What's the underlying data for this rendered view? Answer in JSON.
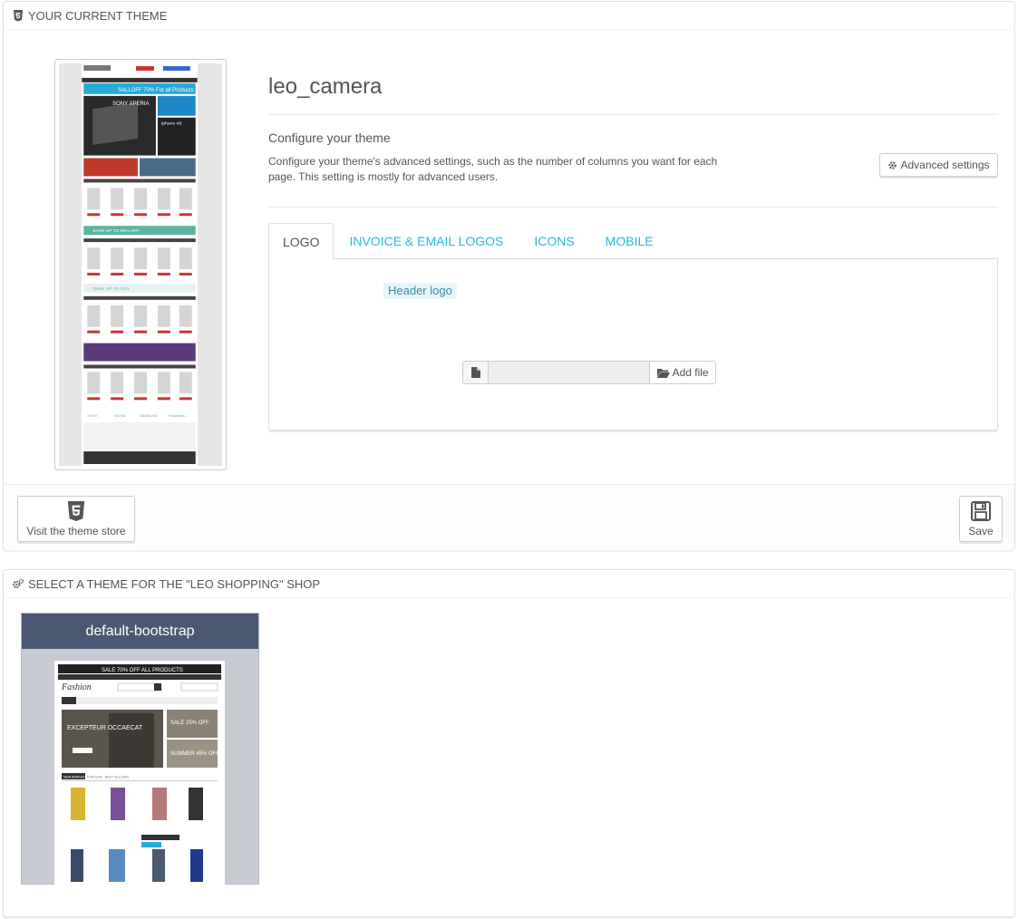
{
  "current_panel": {
    "heading": "YOUR CURRENT THEME",
    "theme_name": "leo_camera",
    "configure_title": "Configure your theme",
    "configure_desc": "Configure your theme's advanced settings, such as the number of columns you want for each page. This setting is mostly for advanced users.",
    "advanced_button": "Advanced settings",
    "tabs": [
      "LOGO",
      "INVOICE & EMAIL LOGOS",
      "ICONS",
      "MOBILE"
    ],
    "header_logo_label": "Header logo",
    "add_file_label": "Add file",
    "file_value": "",
    "visit_store_label": "Visit the theme store",
    "save_label": "Save",
    "thumb_texts": {
      "sale_banner": "SALLOFF 70% For all Products",
      "hero": "SONY XPERIA",
      "side_phone": "Iphone 4S",
      "save_banner_1": "SAVE UP TO 50% OFF",
      "save_banner_2": "SAVE UP TO 20%",
      "brands": [
        "SONY",
        "NOKIA",
        "SAMSUNG",
        "Panasonic"
      ]
    }
  },
  "select_panel": {
    "heading": "SELECT A THEME FOR THE \"LEO SHOPPING\" SHOP",
    "theme_card_name": "default-bootstrap",
    "thumb_texts": {
      "sale_bar": "SALE 70% OFF ALL PRODUCTS",
      "brand": "Fashion",
      "hero_text": "EXCEPTEUR OCCAECAT",
      "promo_1": "SALE 25% OFF",
      "promo_2": "SUMMER 45% OFF",
      "tab_new": "NEW ARRIVALS",
      "tab_popular": "POPULAR",
      "tab_best": "BEST SELLERS"
    }
  },
  "colors": {
    "link": "#25b9d7",
    "card_header": "#4b5873",
    "card_bg": "#c7cad1"
  }
}
